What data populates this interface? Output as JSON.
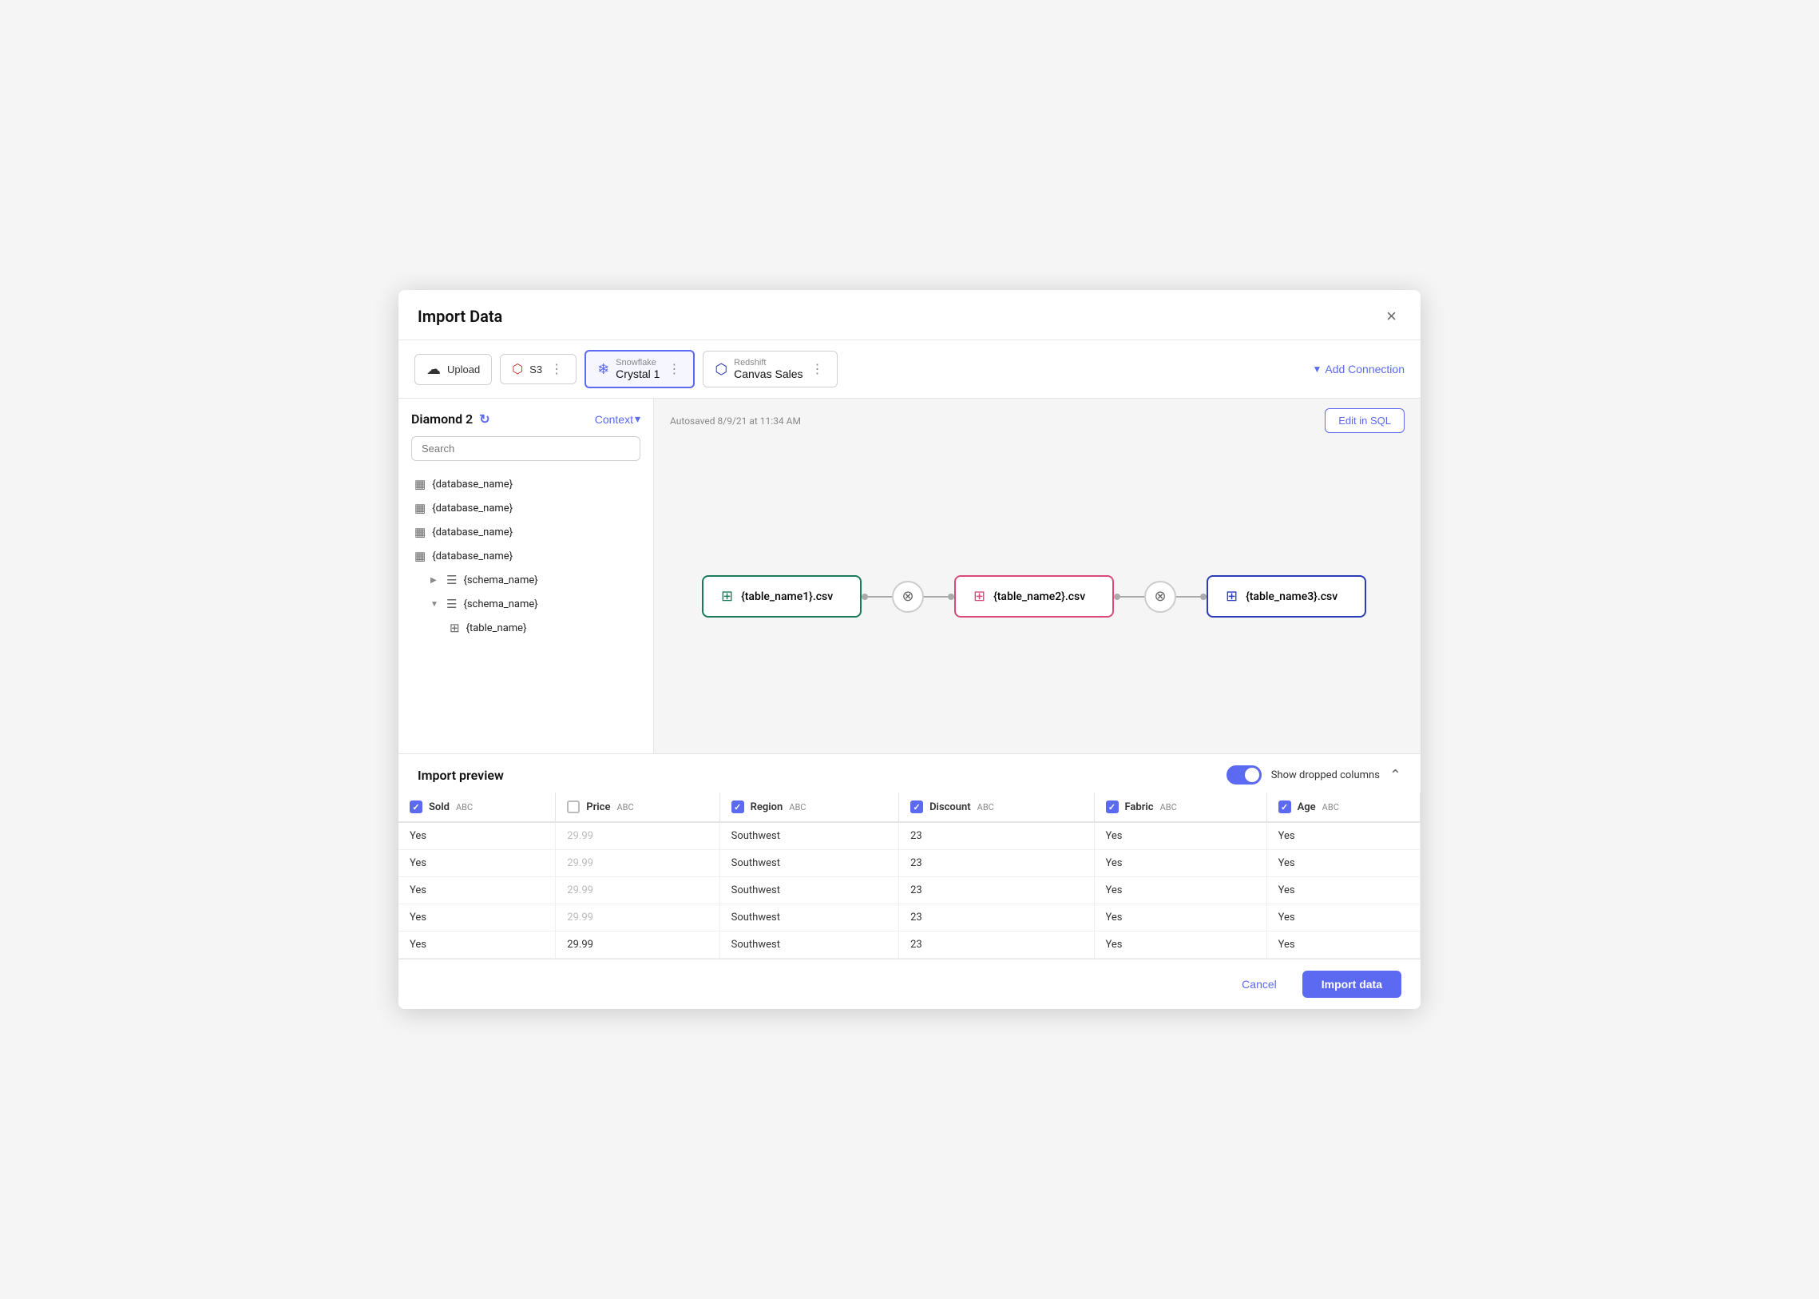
{
  "modal": {
    "title": "Import Data",
    "close_label": "×"
  },
  "connections": [
    {
      "id": "upload",
      "icon": "☁",
      "label": "Upload",
      "sub": "",
      "active": false
    },
    {
      "id": "s3",
      "icon": "🔴",
      "label": "S3",
      "sub": "",
      "active": false
    },
    {
      "id": "snowflake",
      "icon": "❄",
      "label": "Crystal 1",
      "sub": "Snowflake",
      "active": true
    },
    {
      "id": "redshift",
      "icon": "🔷",
      "label": "Canvas Sales",
      "sub": "Redshift",
      "active": false
    }
  ],
  "add_connection_label": "Add Connection",
  "sidebar": {
    "title": "Diamond 2",
    "context_label": "Context",
    "search_placeholder": "Search",
    "tree": [
      {
        "id": 1,
        "label": "{database_name}",
        "indent": 0,
        "type": "db"
      },
      {
        "id": 2,
        "label": "{database_name}",
        "indent": 0,
        "type": "db"
      },
      {
        "id": 3,
        "label": "{database_name}",
        "indent": 0,
        "type": "db"
      },
      {
        "id": 4,
        "label": "{database_name}",
        "indent": 0,
        "type": "db",
        "expanded": true,
        "children": [
          {
            "id": 41,
            "label": "{schema_name}",
            "indent": 1,
            "type": "schema",
            "collapsed": true
          },
          {
            "id": 42,
            "label": "{schema_name}",
            "indent": 1,
            "type": "schema",
            "collapsed": false,
            "children": [
              {
                "id": 421,
                "label": "{table_name}",
                "indent": 2,
                "type": "table"
              }
            ]
          }
        ]
      }
    ]
  },
  "canvas": {
    "autosaved": "Autosaved 8/9/21 at 11:34 AM",
    "edit_sql_label": "Edit in SQL",
    "nodes": [
      {
        "id": "n1",
        "label": "{table_name1}.csv",
        "color": "green"
      },
      {
        "id": "n2",
        "label": "{table_name2}.csv",
        "color": "pink"
      },
      {
        "id": "n3",
        "label": "{table_name3}.csv",
        "color": "blue"
      }
    ]
  },
  "preview": {
    "title": "Import preview",
    "show_dropped_label": "Show dropped columns",
    "columns": [
      {
        "id": "sold",
        "label": "Sold",
        "type": "ABC",
        "checked": true
      },
      {
        "id": "price",
        "label": "Price",
        "type": "ABC",
        "checked": false
      },
      {
        "id": "region",
        "label": "Region",
        "type": "ABC",
        "checked": true
      },
      {
        "id": "discount",
        "label": "Discount",
        "type": "ABC",
        "checked": true
      },
      {
        "id": "fabric",
        "label": "Fabric",
        "type": "ABC",
        "checked": true
      },
      {
        "id": "age",
        "label": "Age",
        "type": "ABC",
        "checked": true
      }
    ],
    "rows": [
      {
        "sold": "Yes",
        "price": "29.99",
        "price_muted": true,
        "region": "Southwest",
        "discount": "23",
        "fabric": "Yes",
        "age": "Yes"
      },
      {
        "sold": "Yes",
        "price": "29.99",
        "price_muted": true,
        "region": "Southwest",
        "discount": "23",
        "fabric": "Yes",
        "age": "Yes"
      },
      {
        "sold": "Yes",
        "price": "29.99",
        "price_muted": true,
        "region": "Southwest",
        "discount": "23",
        "fabric": "Yes",
        "age": "Yes"
      },
      {
        "sold": "Yes",
        "price": "29.99",
        "price_muted": true,
        "region": "Southwest",
        "discount": "23",
        "fabric": "Yes",
        "age": "Yes"
      },
      {
        "sold": "Yes",
        "price": "29.99",
        "price_muted": false,
        "region": "Southwest",
        "discount": "23",
        "fabric": "Yes",
        "age": "Yes"
      }
    ]
  },
  "footer": {
    "cancel_label": "Cancel",
    "import_label": "Import data"
  },
  "colors": {
    "primary": "#5b6af0",
    "green": "#1a7a5a",
    "pink": "#d84a7a",
    "blue": "#2a3db5"
  }
}
